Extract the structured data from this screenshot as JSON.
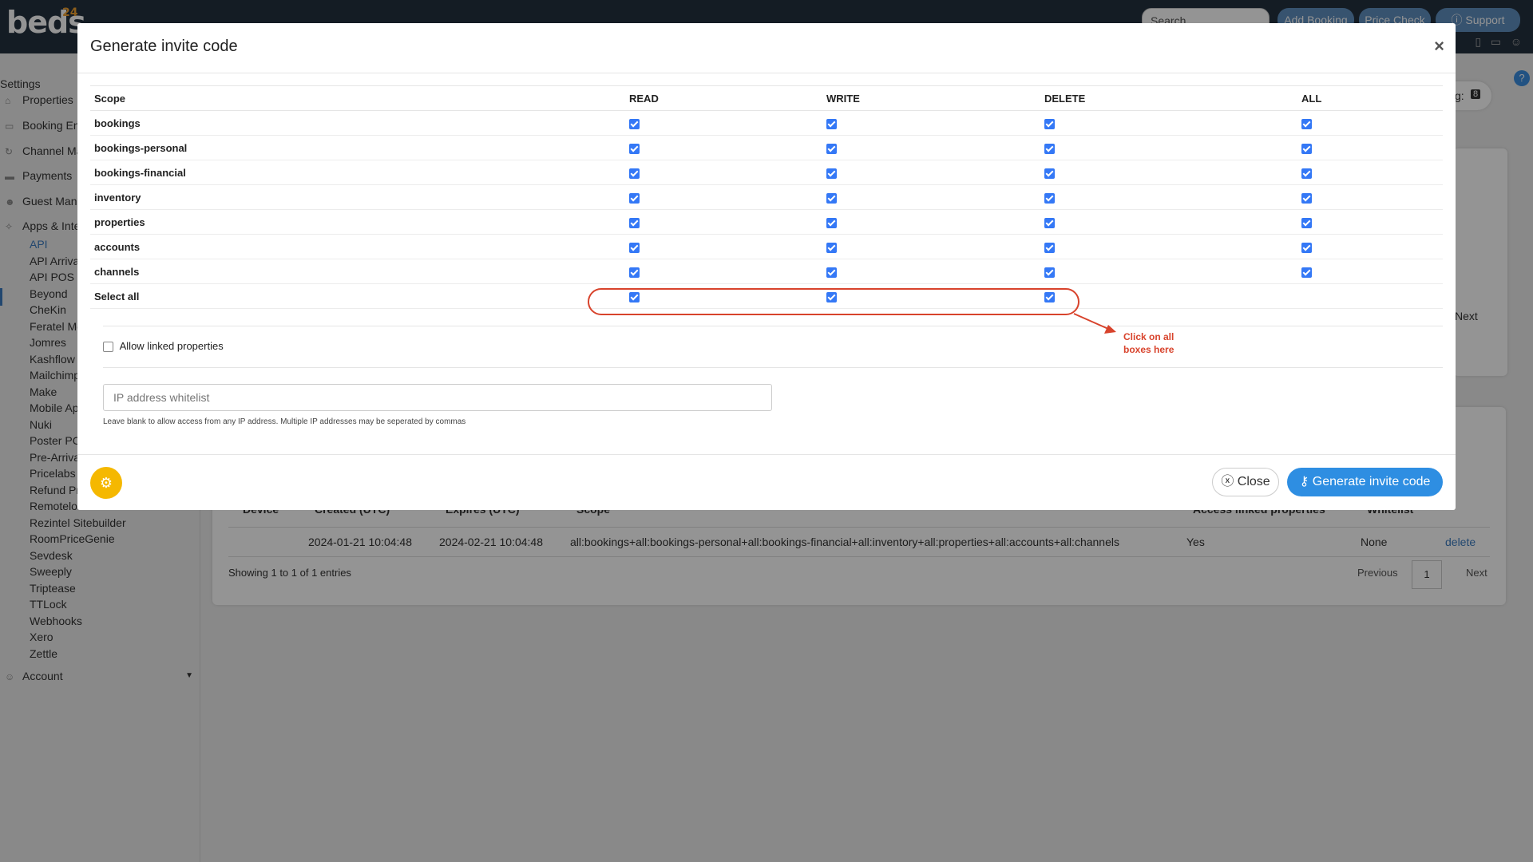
{
  "topbar": {
    "logo_text": "beds",
    "logo_num": "24",
    "search_placeholder": "Search",
    "buttons": [
      {
        "label": "Add Booking"
      },
      {
        "label": "Price Check"
      },
      {
        "label": "ⓘ Support"
      }
    ]
  },
  "sidebar": {
    "title": "Settings",
    "items": [
      {
        "label": "Properties",
        "icon": "house-icon"
      },
      {
        "label": "Booking En",
        "icon": "monitor-icon"
      },
      {
        "label": "Channel Ma",
        "icon": "sync-icon"
      },
      {
        "label": "Payments",
        "icon": "card-icon"
      },
      {
        "label": "Guest Mana",
        "icon": "users-icon"
      },
      {
        "label": "Apps & Inte",
        "icon": "puzzle-icon"
      }
    ],
    "subitems": [
      "API",
      "API Arriva",
      "API POS",
      "Beyond",
      "CheKin",
      "Feratel Me",
      "Jomres",
      "Kashflow",
      "Mailchimp",
      "Make",
      "Mobile Ap",
      "Nuki",
      "Poster PC",
      "Pre-Arriva",
      "Pricelabs",
      "Refund Pr",
      "Remotelo",
      "Rezintel Sitebuilder",
      "RoomPriceGenie",
      "Sevdesk",
      "Sweeply",
      "Triptease",
      "TTLock",
      "Webhooks",
      "Xero",
      "Zettle"
    ],
    "account_label": "Account"
  },
  "background": {
    "badge_label": "g:",
    "badge_value": "8",
    "next_top": "Next",
    "table_headers": [
      "Device",
      "Created (UTC)",
      "Expires (UTC)",
      "Scope",
      "Access linked properties",
      "Whitelist"
    ],
    "row": {
      "created": "2024-01-21 10:04:48",
      "expires": "2024-02-21 10:04:48",
      "scope": "all:bookings+all:bookings-personal+all:bookings-financial+all:inventory+all:properties+all:accounts+all:channels",
      "linked": "Yes",
      "whitelist": "None",
      "action": "delete"
    },
    "showing": "Showing 1 to 1 of 1 entries",
    "pagination": {
      "previous": "Previous",
      "page": "1",
      "next": "Next"
    }
  },
  "modal": {
    "title": "Generate invite code",
    "close_x": "×",
    "columns": [
      "Scope",
      "READ",
      "WRITE",
      "DELETE",
      "ALL"
    ],
    "rows": [
      {
        "scope": "bookings",
        "read": true,
        "write": true,
        "delete": true,
        "all": true
      },
      {
        "scope": "bookings-personal",
        "read": true,
        "write": true,
        "delete": true,
        "all": true
      },
      {
        "scope": "bookings-financial",
        "read": true,
        "write": true,
        "delete": true,
        "all": true
      },
      {
        "scope": "inventory",
        "read": true,
        "write": true,
        "delete": true,
        "all": true
      },
      {
        "scope": "properties",
        "read": true,
        "write": true,
        "delete": true,
        "all": true
      },
      {
        "scope": "accounts",
        "read": true,
        "write": true,
        "delete": true,
        "all": true
      },
      {
        "scope": "channels",
        "read": true,
        "write": true,
        "delete": true,
        "all": true
      }
    ],
    "select_all_label": "Select all",
    "allow_linked_label": "Allow linked properties",
    "allow_linked_checked": false,
    "ip_placeholder": "IP address whitelist",
    "ip_help": "Leave blank to allow access from any IP address. Multiple IP addresses may be seperated by commas",
    "close_button": "Close",
    "generate_button": "Generate invite code"
  },
  "annotation": {
    "line1": "Click on all",
    "line2": "boxes here",
    "color": "#d8432c"
  },
  "colors": {
    "topbar": "#24313f",
    "primary_button": "#2e8ee2",
    "checkbox": "#3478f6",
    "gear_button": "#f5b800"
  }
}
